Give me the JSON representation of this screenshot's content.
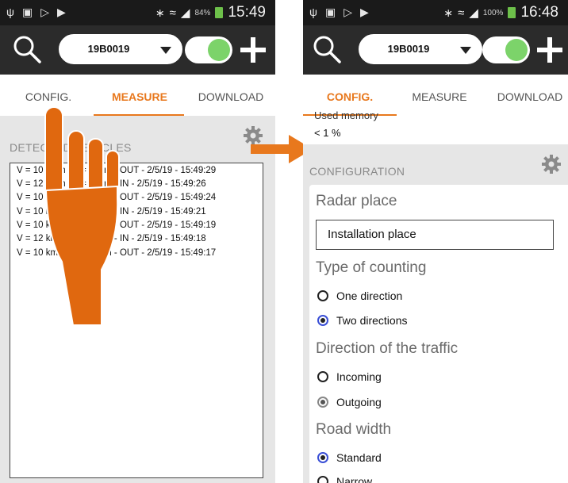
{
  "left_screen": {
    "status": {
      "battery": "84%",
      "time": "15:49"
    },
    "toolbar": {
      "device": "19B0019"
    },
    "tabs": [
      {
        "label": "CONFIG."
      },
      {
        "label": "MEASURE"
      },
      {
        "label": "DOWNLOAD"
      }
    ],
    "section_title": "DETECTED VEHICLES",
    "vehicles": [
      "V = 10 km/h - L = 0.7 m - OUT - 2/5/19 - 15:49:29",
      "V = 12 km/h - L = 0.7 m - IN - 2/5/19 - 15:49:26",
      "V = 10 km/h - L = 0.6 m - OUT - 2/5/19 - 15:49:24",
      "V = 10 km/h - L = 0.6 m - IN - 2/5/19 - 15:49:21",
      "V = 10 km/h - L = 0.9 m - OUT - 2/5/19 - 15:49:19",
      "V = 12 km/h - L = 0.7 m - IN - 2/5/19 - 15:49:18",
      "V = 10 km/h - L = 0.5 m - OUT - 2/5/19 - 15:49:17"
    ]
  },
  "right_screen": {
    "status": {
      "battery": "100%",
      "time": "16:48"
    },
    "toolbar": {
      "device": "19B0019"
    },
    "tabs": [
      {
        "label": "CONFIG."
      },
      {
        "label": "MEASURE"
      },
      {
        "label": "DOWNLOAD"
      }
    ],
    "used_memory_label": "Used memory",
    "used_memory_value": "< 1 %",
    "section_title": "CONFIGURATION",
    "radar_place": {
      "label": "Radar place",
      "value": "Installation place"
    },
    "type_of_counting": {
      "label": "Type of counting",
      "options": [
        "One direction",
        "Two directions"
      ],
      "selected": "Two directions"
    },
    "direction_of_traffic": {
      "label": "Direction of the traffic",
      "options": [
        "Incoming",
        "Outgoing"
      ],
      "selected": "Outgoing"
    },
    "road_width": {
      "label": "Road width",
      "options": [
        "Standard",
        "Narrow"
      ],
      "selected": "Standard"
    }
  },
  "colors": {
    "accent": "#e8781d",
    "toggle_on": "#7cd36a",
    "toolbar": "#2b2b2b",
    "radio_selected": "#3a4fd6"
  }
}
